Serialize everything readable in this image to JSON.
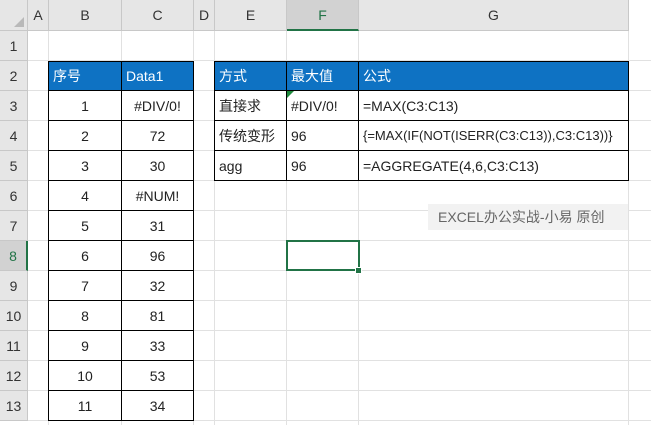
{
  "sheet": {
    "columns": [
      "A",
      "B",
      "C",
      "D",
      "E",
      "F",
      "G"
    ],
    "rows": [
      "1",
      "2",
      "3",
      "4",
      "5",
      "6",
      "7",
      "8",
      "9",
      "10",
      "11",
      "12",
      "13"
    ],
    "active_cell": "F8"
  },
  "table1": {
    "headers": [
      "序号",
      "Data1"
    ],
    "rows": [
      [
        "1",
        "#DIV/0!"
      ],
      [
        "2",
        "72"
      ],
      [
        "3",
        "30"
      ],
      [
        "4",
        "#NUM!"
      ],
      [
        "5",
        "31"
      ],
      [
        "6",
        "96"
      ],
      [
        "7",
        "32"
      ],
      [
        "8",
        "81"
      ],
      [
        "9",
        "33"
      ],
      [
        "10",
        "53"
      ],
      [
        "11",
        "34"
      ]
    ]
  },
  "table2": {
    "headers": [
      "方式",
      "最大值",
      "公式"
    ],
    "rows": [
      [
        "直接求",
        "#DIV/0!",
        "=MAX(C3:C13)"
      ],
      [
        "传统变形",
        "96",
        "{=MAX(IF(NOT(ISERR(C3:C13)),C3:C13))}"
      ],
      [
        "agg",
        "96",
        "=AGGREGATE(4,6,C3:C13)"
      ]
    ]
  },
  "note": {
    "text": "EXCEL办公实战-小易 原创"
  },
  "colors": {
    "header_fill": "#0e72c3",
    "selection": "#217346",
    "error_marker": "#1e8a3c"
  }
}
